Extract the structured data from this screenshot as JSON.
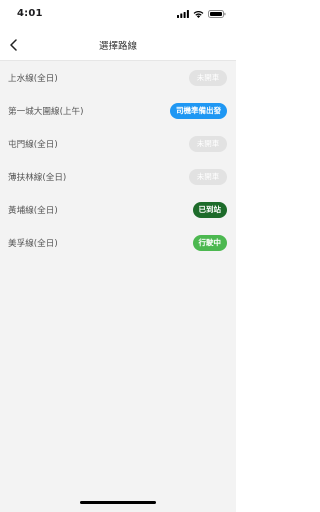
{
  "status_bar": {
    "time": "4:01",
    "icons": [
      "cellular-signal-icon",
      "wifi-icon",
      "battery-icon"
    ]
  },
  "nav": {
    "back_icon": "chevron-left-icon",
    "title": "選擇路線"
  },
  "routes": [
    {
      "name": "上水線(全日)",
      "status": "未開車",
      "status_type": "closed"
    },
    {
      "name": "第一城大圍線(上午)",
      "status": "司機準備出發",
      "status_type": "ready"
    },
    {
      "name": "屯門線(全日)",
      "status": "未開車",
      "status_type": "closed"
    },
    {
      "name": "薄扶林線(全日)",
      "status": "未開車",
      "status_type": "closed"
    },
    {
      "name": "黃埔線(全日)",
      "status": "已到站",
      "status_type": "arrived"
    },
    {
      "name": "美孚線(全日)",
      "status": "行駛中",
      "status_type": "running"
    }
  ],
  "colors": {
    "closed": "#e2e2e2",
    "ready": "#1f97f3",
    "arrived": "#1d6b2a",
    "running": "#4cb850",
    "background": "#f3f3f3"
  }
}
